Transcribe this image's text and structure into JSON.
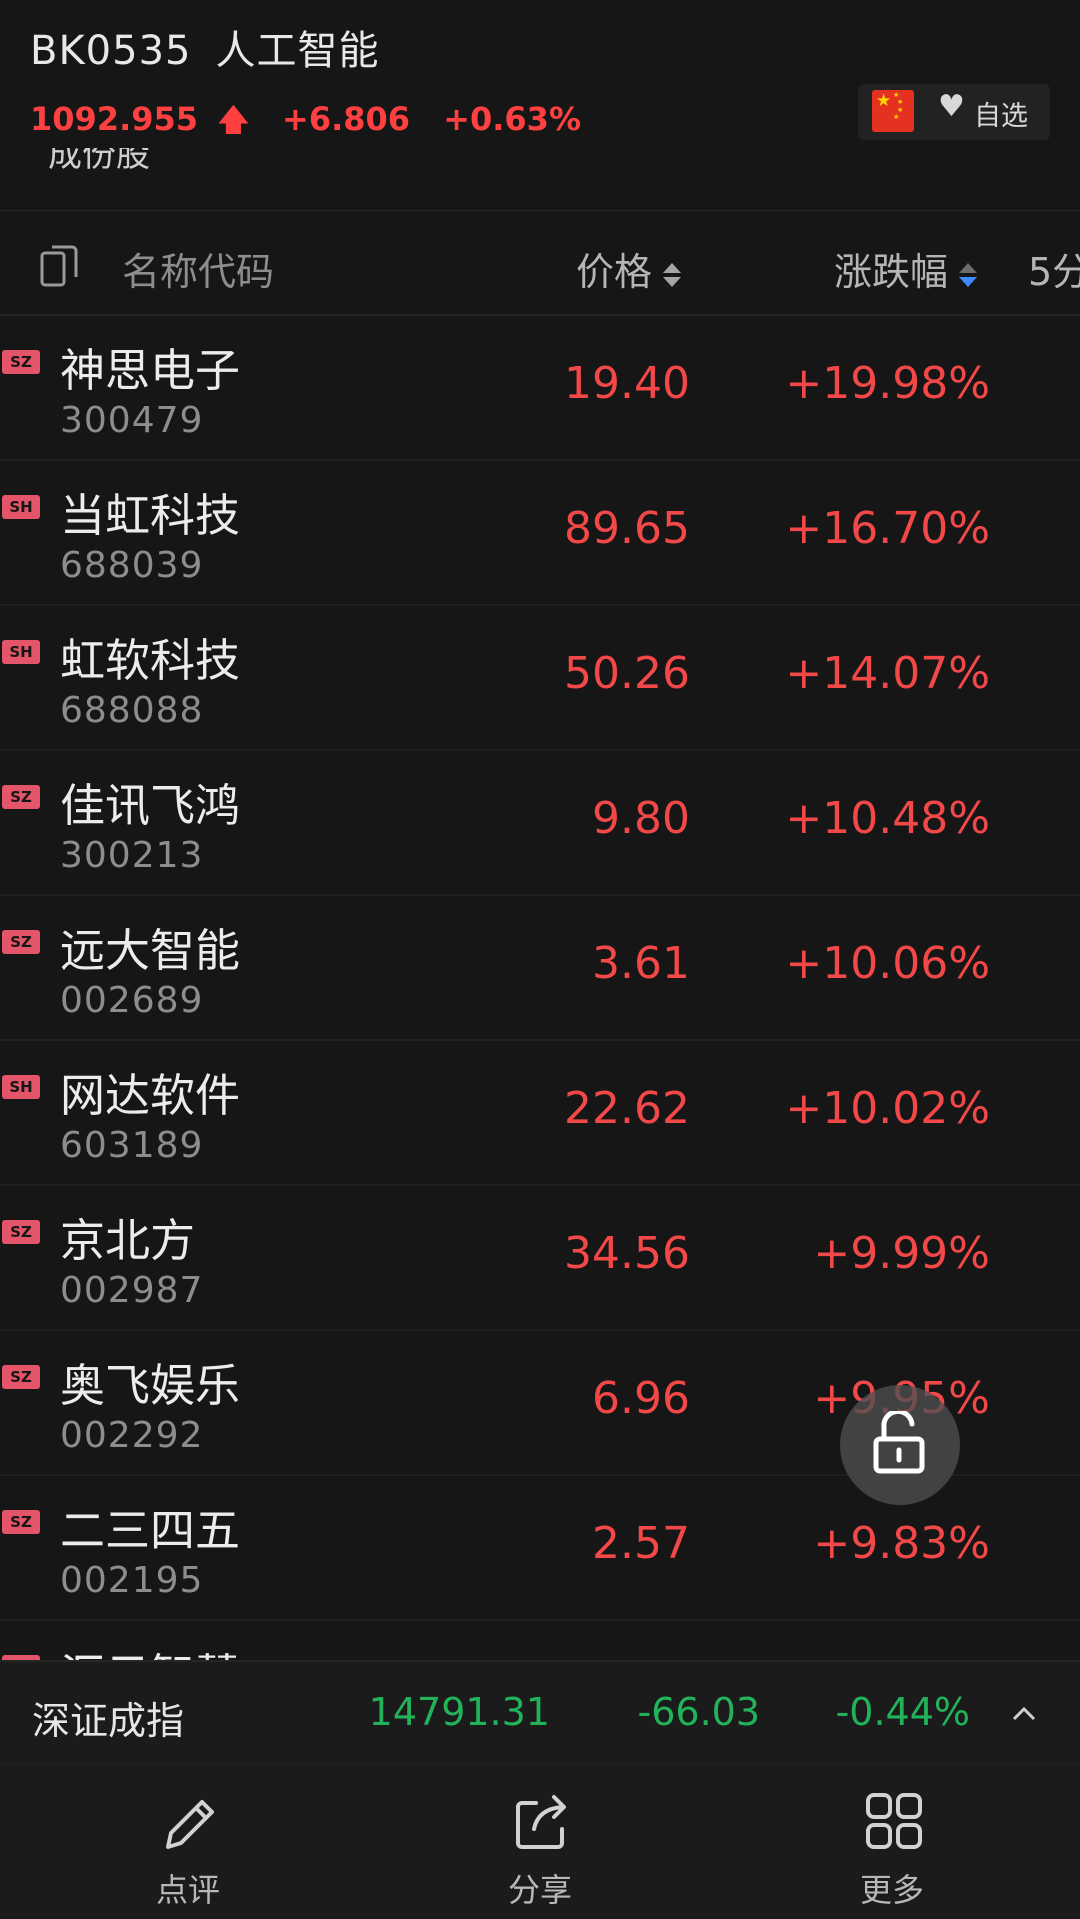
{
  "header": {
    "code": "BK0535",
    "name": "人工智能",
    "price": "1092.955",
    "change": "+6.806",
    "change_pct": "+0.63%",
    "subtitle_clipped": "成份股",
    "watchlist_label": "自选",
    "flag": "china-flag"
  },
  "columns": {
    "name": "名称代码",
    "price": "价格",
    "change": "涨跌幅",
    "five_min": "5分"
  },
  "stocks": [
    {
      "market": "SZ",
      "name": "神思电子",
      "code": "300479",
      "price": "19.40",
      "change": "+19.98%"
    },
    {
      "market": "SH",
      "name": "当虹科技",
      "code": "688039",
      "price": "89.65",
      "change": "+16.70%"
    },
    {
      "market": "SH",
      "name": "虹软科技",
      "code": "688088",
      "price": "50.26",
      "change": "+14.07%"
    },
    {
      "market": "SZ",
      "name": "佳讯飞鸿",
      "code": "300213",
      "price": "9.80",
      "change": "+10.48%"
    },
    {
      "market": "SZ",
      "name": "远大智能",
      "code": "002689",
      "price": "3.61",
      "change": "+10.06%"
    },
    {
      "market": "SH",
      "name": "网达软件",
      "code": "603189",
      "price": "22.62",
      "change": "+10.02%"
    },
    {
      "market": "SZ",
      "name": "京北方",
      "code": "002987",
      "price": "34.56",
      "change": "+9.99%"
    },
    {
      "market": "SZ",
      "name": "奥飞娱乐",
      "code": "002292",
      "price": "6.96",
      "change": "+9.95%"
    },
    {
      "market": "SZ",
      "name": "二三四五",
      "code": "002195",
      "price": "2.57",
      "change": "+9.83%"
    },
    {
      "market": "SZ",
      "name": "汇云智慧",
      "code": "",
      "price": "",
      "change": ""
    }
  ],
  "index_bar": {
    "name": "深证成指",
    "value": "14791.31",
    "change": "-66.03",
    "change_pct": "-0.44%"
  },
  "toolbar": {
    "comment": "点评",
    "share": "分享",
    "more": "更多"
  },
  "colors": {
    "up": "#f24848",
    "down": "#22b35a",
    "background": "#161616",
    "badge": "#e55569",
    "sort_active": "#3d8bff"
  }
}
